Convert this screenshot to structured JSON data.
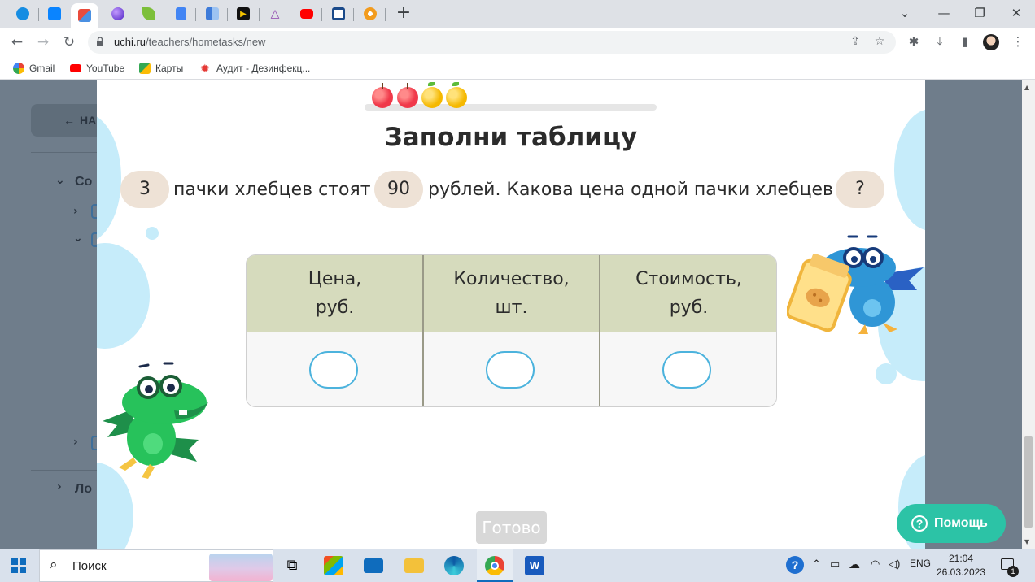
{
  "browser": {
    "tabs": [
      {
        "icon": "mail-ru-icon",
        "color": "#168de2"
      },
      {
        "icon": "chat-icon",
        "color": "#0a84ff"
      },
      {
        "icon": "uchi-icon",
        "color": "#e94b3c"
      },
      {
        "icon": "sphere-icon",
        "color": "#7b3ff2"
      },
      {
        "icon": "leaf-icon",
        "color": "#7cbf3a"
      },
      {
        "icon": "docs-icon",
        "color": "#4285f4"
      },
      {
        "icon": "tile-icon",
        "color": "#3d7bd9"
      },
      {
        "icon": "play-icon",
        "color": "#111111"
      },
      {
        "icon": "triangle-icon",
        "color": "#8e44ad"
      },
      {
        "icon": "youtube-icon",
        "color": "#ff0000"
      },
      {
        "icon": "screen-icon",
        "color": "#1a4a8a"
      },
      {
        "icon": "orange-wheel-icon",
        "color": "#f29b1d"
      }
    ],
    "url_host": "uchi.ru",
    "url_path": "/teachers/hometasks/new",
    "bookmarks": [
      {
        "label": "Gmail",
        "icon": "google-icon",
        "color": "#4285f4"
      },
      {
        "label": "YouTube",
        "icon": "youtube-icon",
        "color": "#ff0000"
      },
      {
        "label": "Карты",
        "icon": "maps-icon",
        "color": "#34a853"
      },
      {
        "label": "Аудит - Дезинфекц...",
        "icon": "star-burst-icon",
        "color": "#e53935"
      }
    ]
  },
  "background_page": {
    "back_button": "НА",
    "section_1": "Со",
    "section_2": "Ло"
  },
  "task": {
    "title": "Заполни таблицу",
    "progress": {
      "total_apples": 4,
      "red_apples": 2,
      "yellow_apples": 2
    },
    "problem": {
      "chip_1": "3",
      "text_1": "пачки хлебцев стоят",
      "chip_2": "90",
      "text_2": "рублей. Какова цена одной пачки хлебцев",
      "chip_3": "?"
    },
    "table": {
      "headers": [
        "Цена,\nруб.",
        "Количество,\nшт.",
        "Стоимость,\nруб."
      ],
      "inputs": [
        "",
        "",
        ""
      ]
    },
    "ready_button": "Готово",
    "help_button": "Помощь",
    "colors": {
      "header_bg": "#d6dbbd",
      "chip_bg": "#eee2d6",
      "input_border": "#4cb3dd",
      "help_bg": "#2cc3a6",
      "blob": "#c6ecfa"
    }
  },
  "taskbar": {
    "search_label": "Поиск",
    "lang": "ENG",
    "time": "21:04",
    "date": "26.03.2023",
    "notifications": "1"
  }
}
